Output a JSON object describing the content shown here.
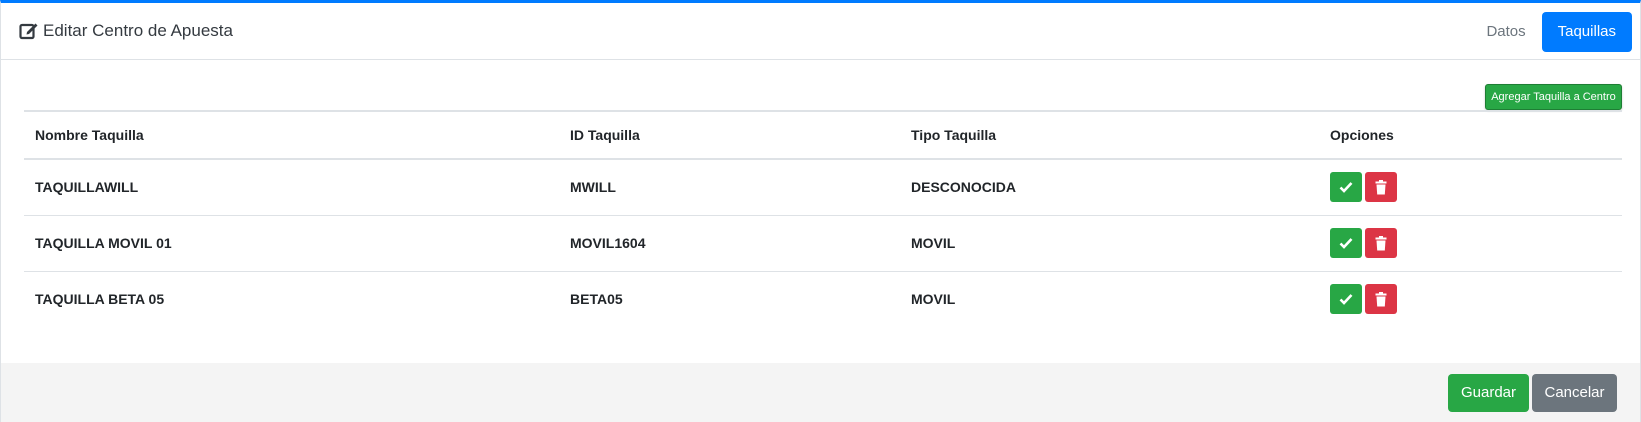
{
  "header": {
    "title": "Editar Centro de Apuesta",
    "title_icon": "edit-icon",
    "tabs": [
      {
        "label": "Datos",
        "active": false
      },
      {
        "label": "Taquillas",
        "active": true
      }
    ]
  },
  "toolbar": {
    "add_label": "Agregar Taquilla a Centro"
  },
  "table": {
    "headers": [
      "Nombre Taquilla",
      "ID Taquilla",
      "Tipo Taquilla",
      "Opciones"
    ],
    "rows": [
      {
        "nombre": "TAQUILLAWILL",
        "id": "MWILL",
        "tipo": "DESCONOCIDA"
      },
      {
        "nombre": "TAQUILLA MOVIL 01",
        "id": "MOVIL1604",
        "tipo": "MOVIL"
      },
      {
        "nombre": "TAQUILLA BETA 05",
        "id": "BETA05",
        "tipo": "MOVIL"
      }
    ],
    "row_actions": {
      "confirm_icon": "check-icon",
      "delete_icon": "trash-icon"
    }
  },
  "footer": {
    "save_label": "Guardar",
    "cancel_label": "Cancelar"
  },
  "colors": {
    "primary": "#007bff",
    "success": "#28a745",
    "danger": "#dc3545",
    "secondary": "#6c757d"
  }
}
